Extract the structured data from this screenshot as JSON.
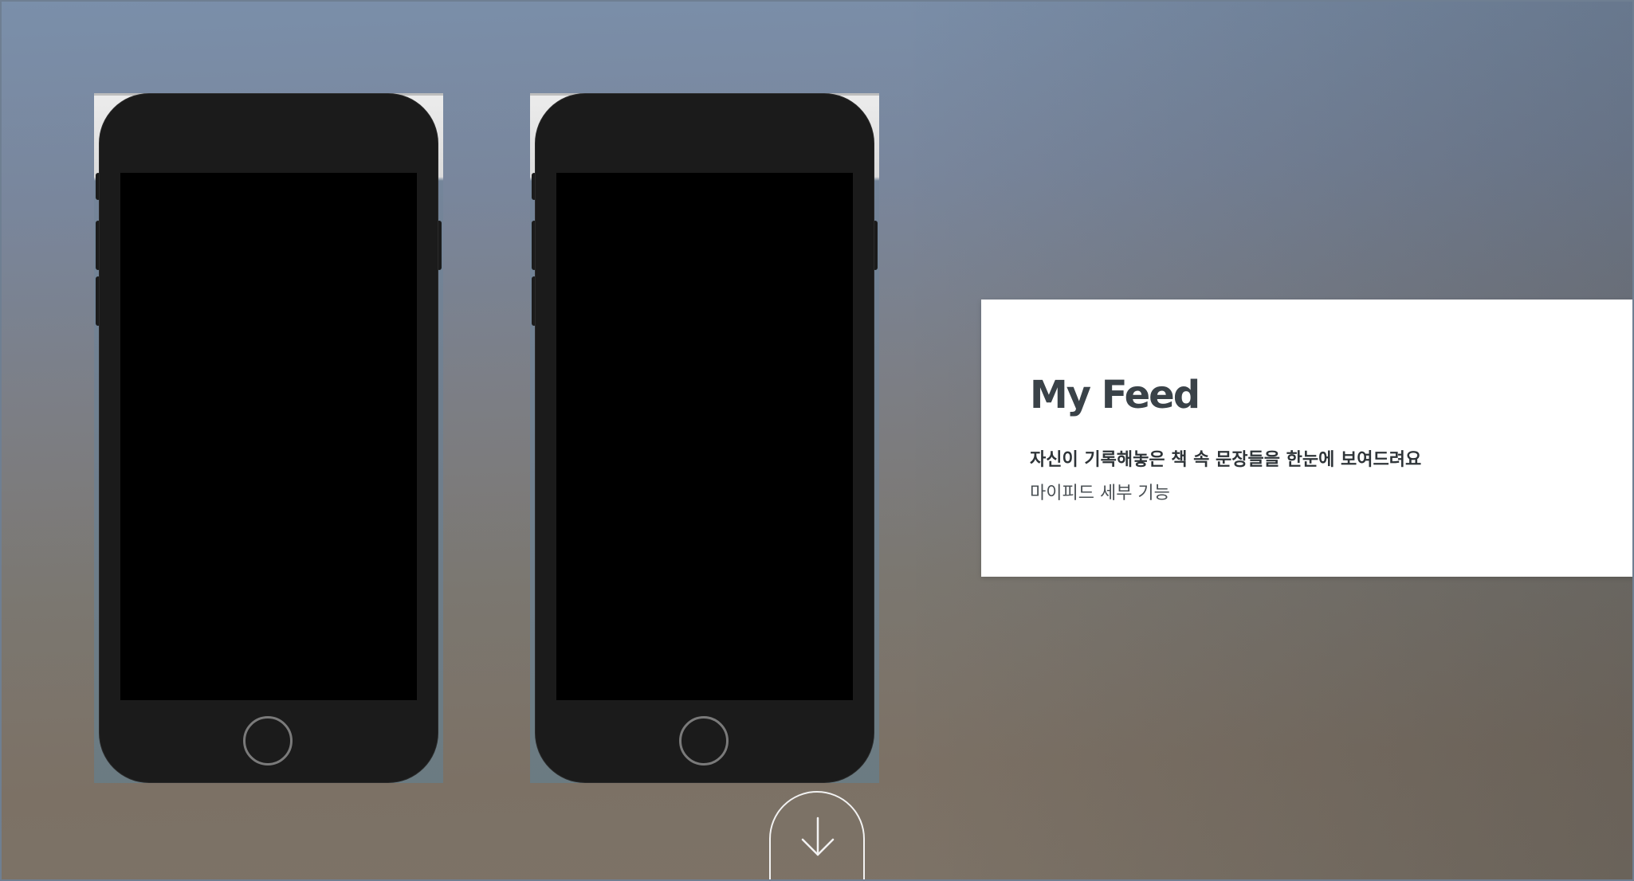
{
  "feature": {
    "title": "My Feed",
    "description": "자신이 기록해놓은 책 속 문장들을 한눈에 보여드려요",
    "subtitle": "마이피드 세부 기능"
  },
  "phones": [
    {
      "screen": "black"
    },
    {
      "screen": "black"
    }
  ],
  "scroll_button": {
    "icon": "arrow-down-icon"
  },
  "colors": {
    "card_background": "#ffffff",
    "title_color": "#3a4248",
    "phone_body": "#1b1b1b",
    "phone_screen": "#000000",
    "scroll_button_outline": "#f2f2f2"
  }
}
